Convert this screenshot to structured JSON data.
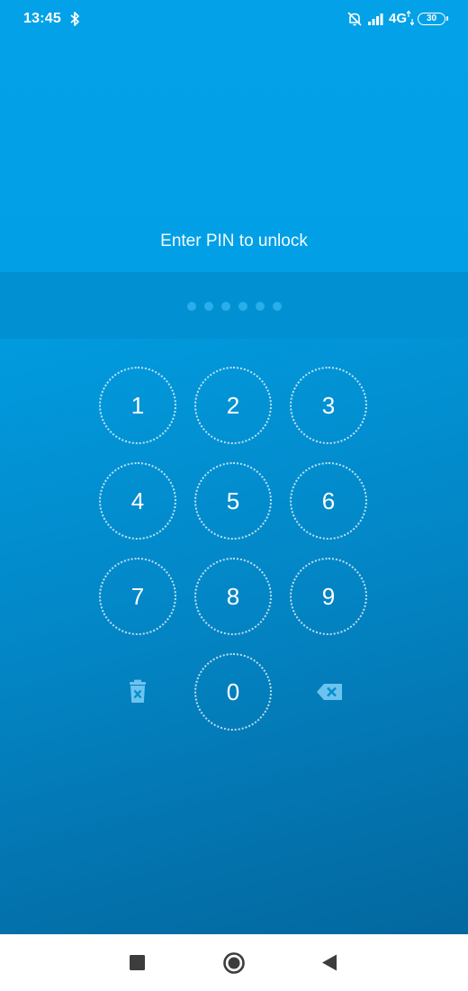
{
  "status_bar": {
    "time": "13:45",
    "network": "4G",
    "battery": "30"
  },
  "lock_screen": {
    "prompt": "Enter PIN to unlock",
    "pin_length": 6,
    "keys": [
      "1",
      "2",
      "3",
      "4",
      "5",
      "6",
      "7",
      "8",
      "9",
      "0"
    ]
  },
  "icons": {
    "clear": "trash-icon",
    "backspace": "backspace-icon",
    "nav_recents": "square-icon",
    "nav_home": "circle-icon",
    "nav_back": "triangle-back-icon"
  },
  "colors": {
    "background_top": "#02a5ea",
    "background_bottom": "#03679e",
    "pin_band": "#0191d2",
    "pin_dot": "#28aeea",
    "icon_muted": "#6cc4ee",
    "nav_icons": "#3d3d3d"
  }
}
